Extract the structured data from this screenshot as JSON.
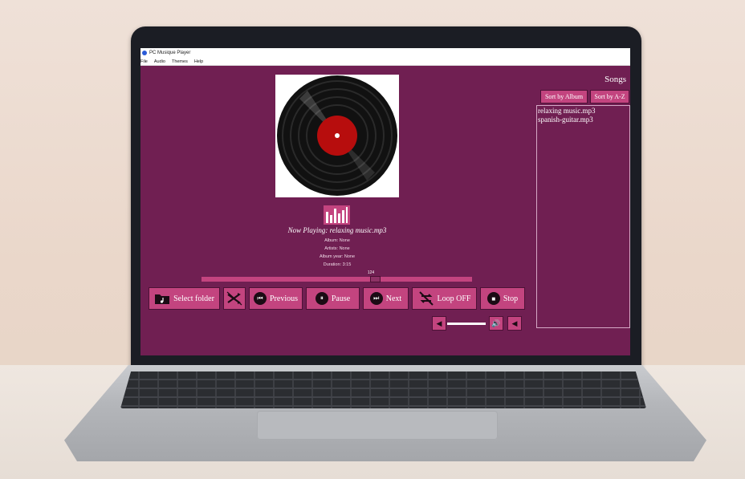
{
  "window": {
    "title": "PC Musique Player"
  },
  "menu": [
    "File",
    "Audio",
    "Themes",
    "Help"
  ],
  "player": {
    "now_playing": "Now Playing: relaxing music.mp3",
    "album": "Album: None",
    "artists": "Artists: None",
    "album_year": "Album year: None",
    "duration": "Duration: 3:15",
    "progress_value": "124",
    "progress_fraction": 0.64
  },
  "controls": {
    "select_folder": "Select folder",
    "previous": "Previous",
    "pause": "Pause",
    "next": "Next",
    "loop": "Loop OFF",
    "stop": "Stop"
  },
  "songs": {
    "title": "Songs",
    "sort_album": "Sort by Album",
    "sort_az": "Sort by A-Z",
    "items": [
      "relaxing music.mp3",
      "spanish-guitar.mp3"
    ]
  },
  "colors": {
    "app_bg": "#701f52",
    "button": "#c3447f",
    "button_border": "#4d1136"
  },
  "icons": [
    "folder-music-icon",
    "no-shuffle-icon",
    "previous-icon",
    "pause-icon",
    "next-icon",
    "loop-off-icon",
    "stop-icon",
    "volume-down-icon",
    "speaker-icon",
    "mute-icon",
    "equalizer-icon",
    "vinyl-record-icon"
  ]
}
